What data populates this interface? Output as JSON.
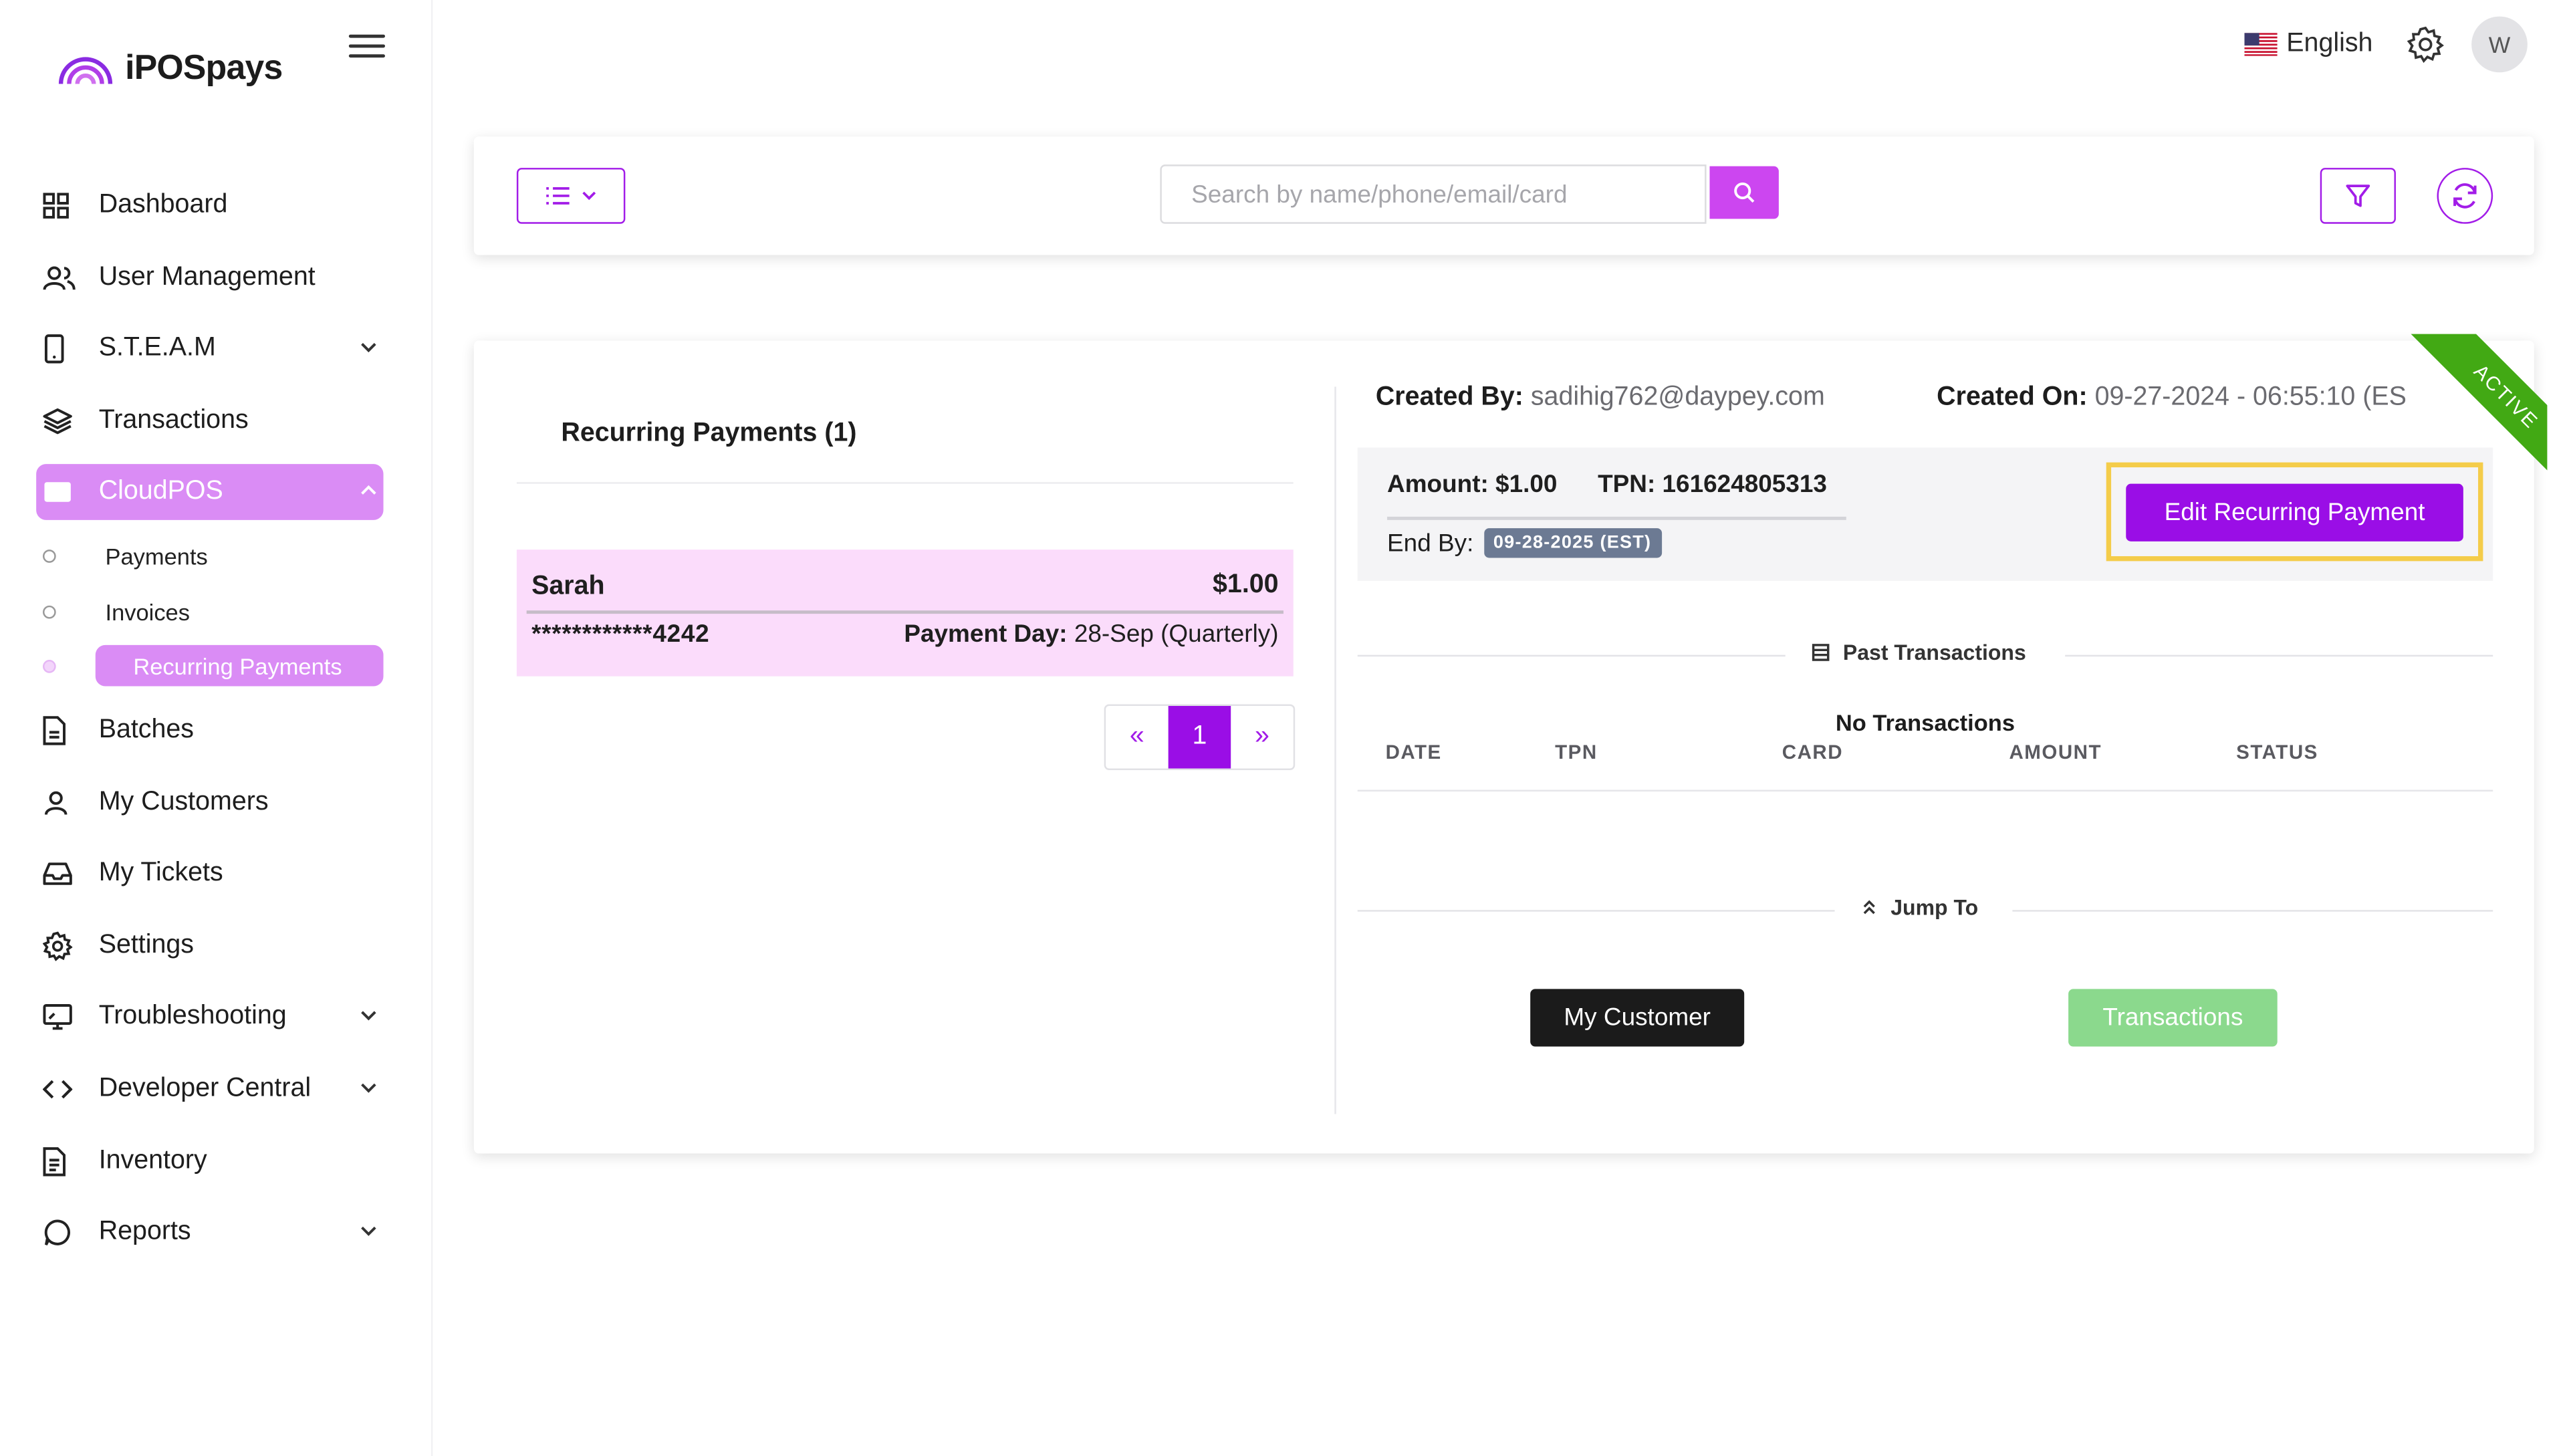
{
  "brand": {
    "name": "iPOSpays",
    "accent": "#a21ce8"
  },
  "topbar": {
    "language": "English",
    "avatar_initial": "W"
  },
  "sidebar": {
    "items": [
      {
        "label": "Dashboard",
        "icon": "grid-icon"
      },
      {
        "label": "User Management",
        "icon": "users-icon"
      },
      {
        "label": "S.T.E.A.M",
        "icon": "tablet-icon",
        "expandable": true
      },
      {
        "label": "Transactions",
        "icon": "layers-icon"
      },
      {
        "label": "CloudPOS",
        "icon": "card-icon",
        "expanded": true,
        "active": true
      },
      {
        "label": "Batches",
        "icon": "file-icon"
      },
      {
        "label": "My Customers",
        "icon": "user-icon"
      },
      {
        "label": "My Tickets",
        "icon": "inbox-icon"
      },
      {
        "label": "Settings",
        "icon": "gear-icon"
      },
      {
        "label": "Troubleshooting",
        "icon": "monitor-icon",
        "expandable": true
      },
      {
        "label": "Developer Central",
        "icon": "code-icon",
        "expandable": true
      },
      {
        "label": "Inventory",
        "icon": "document-icon"
      },
      {
        "label": "Reports",
        "icon": "chat-icon",
        "expandable": true
      }
    ],
    "cloudpos_sub": [
      {
        "label": "Payments"
      },
      {
        "label": "Invoices"
      },
      {
        "label": "Recurring Payments",
        "active": true
      }
    ]
  },
  "toolbar": {
    "search_placeholder": "Search by name/phone/email/card"
  },
  "list": {
    "title": "Recurring Payments (1)",
    "rows": [
      {
        "name": "Sarah",
        "amount": "$1.00",
        "card": "************4242",
        "payment_day_label": "Payment Day:",
        "payment_day": "28-Sep (Quarterly)"
      }
    ],
    "pagination": {
      "prev": "«",
      "current": "1",
      "next": "»"
    }
  },
  "detail": {
    "created_by_label": "Created By:",
    "created_by": "sadihig762@daypey.com",
    "created_on_label": "Created On:",
    "created_on": "09-27-2024 - 06:55:10 (ES",
    "status_ribbon": "ACTIVE",
    "amount": "Amount: $1.00",
    "tpn": "TPN: 161624805313",
    "end_by_label": "End By:",
    "end_by": "09-28-2025 (EST)",
    "edit_button": "Edit Recurring Payment",
    "past_transactions_title": "Past Transactions",
    "no_transactions": "No Transactions",
    "columns": [
      "DATE",
      "TPN",
      "CARD",
      "AMOUNT",
      "STATUS"
    ],
    "jump_to_title": "Jump To",
    "my_customer_button": "My Customer",
    "transactions_button": "Transactions"
  }
}
